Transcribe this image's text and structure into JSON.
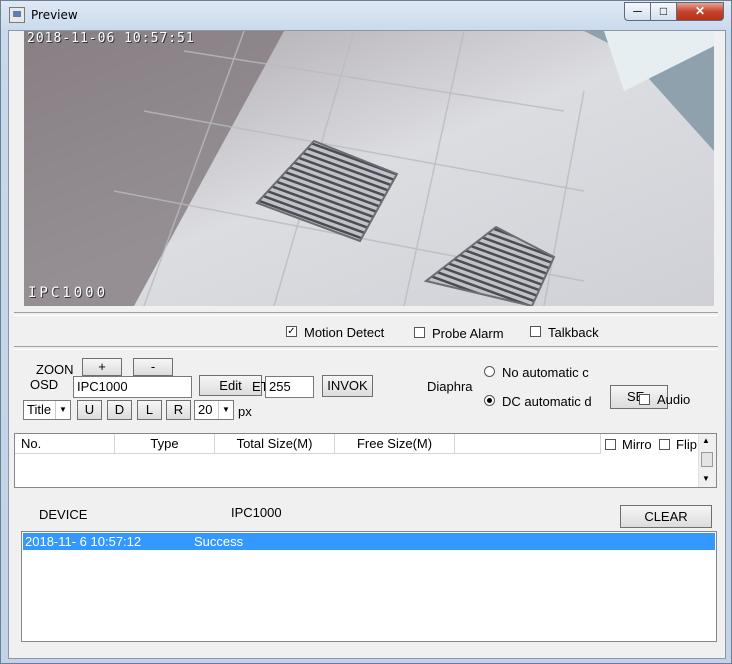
{
  "window": {
    "title": "Preview",
    "min": "─",
    "max": "□",
    "close": "✕"
  },
  "video": {
    "osd_time": "2018-11-06  10:57:51",
    "osd_name": "IPC1000"
  },
  "options": {
    "motion_detect": "Motion Detect",
    "probe_alarm": "Probe Alarm",
    "talkback": "Talkback"
  },
  "ptz": {
    "zoom_label": "ZOON",
    "zoom_plus": "+",
    "zoom_minus": "-",
    "osd_label": "OSD",
    "osd_value": "IPC1000",
    "edit": "Edit",
    "preset_label": "ET",
    "preset_value": "255",
    "invoke": "INVOK",
    "title_select": "Title",
    "up": "U",
    "down": "D",
    "left": "L",
    "right": "R",
    "size_value": "20",
    "px": "px"
  },
  "diaphragm": {
    "label": "Diaphra",
    "no_auto": "No automatic c",
    "dc_auto": "DC automatic d",
    "set_btn": "SE",
    "audio": "Audio"
  },
  "table": {
    "columns": [
      "No.",
      "Type",
      "Total Size(M)",
      "Free Size(M)"
    ],
    "mirror": "Mirro",
    "flip": "Flip"
  },
  "device": {
    "label": "DEVICE",
    "value": "IPC1000",
    "clear": "CLEAR"
  },
  "log": [
    {
      "time": "2018-11- 6  10:57:12",
      "message": "Success"
    }
  ]
}
